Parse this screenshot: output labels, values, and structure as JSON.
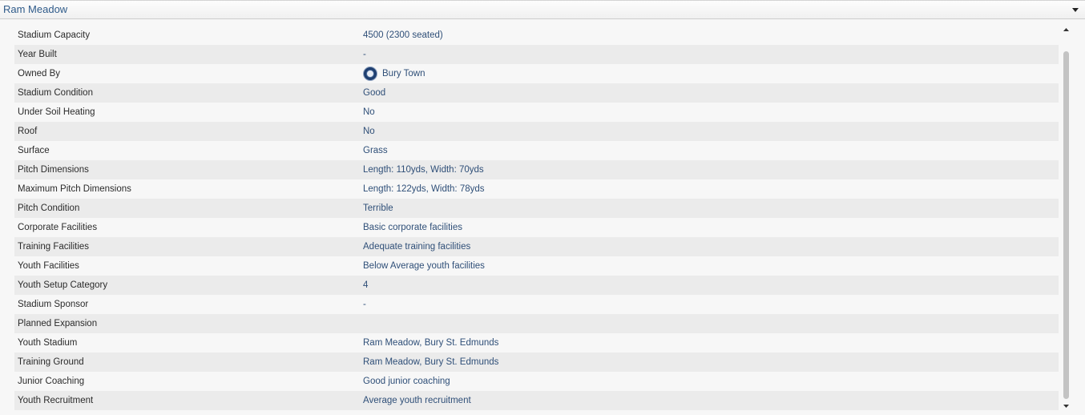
{
  "header": {
    "title": "Ram Meadow",
    "toggle_icon": "chevron-down-icon"
  },
  "rows": [
    {
      "label": "Stadium Capacity",
      "value": "4500 (2300 seated)"
    },
    {
      "label": "Year Built",
      "value": "-"
    },
    {
      "label": "Owned By",
      "value": "Bury Town",
      "icon": "club-badge-icon"
    },
    {
      "label": "Stadium Condition",
      "value": "Good"
    },
    {
      "label": "Under Soil Heating",
      "value": "No"
    },
    {
      "label": "Roof",
      "value": "No"
    },
    {
      "label": "Surface",
      "value": "Grass"
    },
    {
      "label": "Pitch Dimensions",
      "value": "Length: 110yds, Width: 70yds"
    },
    {
      "label": "Maximum Pitch Dimensions",
      "value": "Length: 122yds, Width: 78yds"
    },
    {
      "label": "Pitch Condition",
      "value": "Terrible"
    },
    {
      "label": "Corporate Facilities",
      "value": "Basic corporate facilities"
    },
    {
      "label": "Training Facilities",
      "value": "Adequate training facilities"
    },
    {
      "label": "Youth Facilities",
      "value": "Below Average youth facilities"
    },
    {
      "label": "Youth Setup Category",
      "value": "4"
    },
    {
      "label": "Stadium Sponsor",
      "value": "-"
    },
    {
      "label": "Planned Expansion",
      "value": ""
    },
    {
      "label": "Youth Stadium",
      "value": "Ram Meadow, Bury St. Edmunds"
    },
    {
      "label": "Training Ground",
      "value": "Ram Meadow, Bury St. Edmunds"
    },
    {
      "label": "Junior Coaching",
      "value": "Good junior coaching"
    },
    {
      "label": "Youth Recruitment",
      "value": "Average youth recruitment"
    }
  ],
  "colors": {
    "title": "#2f5b8a",
    "value_text": "#2f4f78",
    "label_text": "#2b2b2b",
    "row_alt": "#ebebeb"
  }
}
